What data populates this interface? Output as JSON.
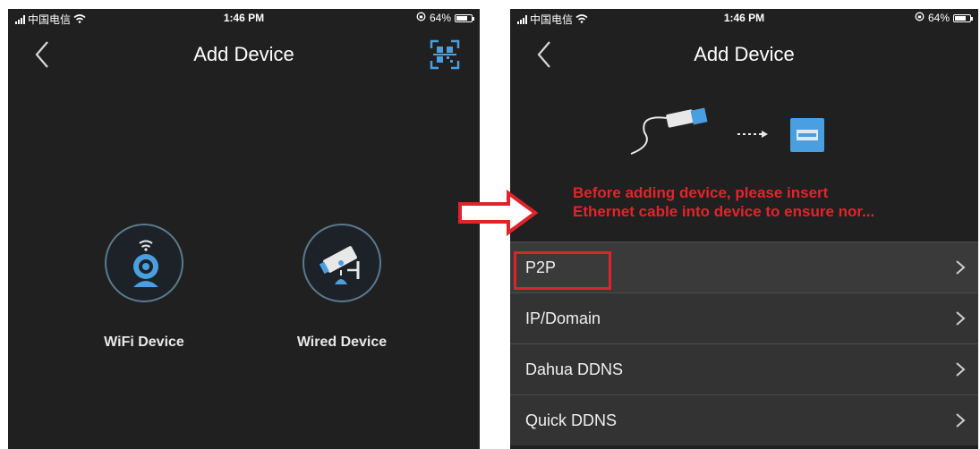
{
  "status_bar": {
    "carrier": "中国电信",
    "time": "1:46 PM",
    "battery": "64%",
    "battery_level": 0.64
  },
  "left_screen": {
    "title": "Add Device",
    "back_icon": "chevron-left-icon",
    "scan_icon": "qr-scan-icon",
    "options": [
      {
        "label": "WiFi Device",
        "icon": "wifi-camera-icon"
      },
      {
        "label": "Wired Device",
        "icon": "wired-camera-icon"
      }
    ]
  },
  "right_screen": {
    "title": "Add Device",
    "back_icon": "chevron-left-icon",
    "warning_lines": [
      "Before adding device, please insert",
      "Ethernet cable into device to ensure nor..."
    ],
    "methods": [
      {
        "label": "P2P",
        "highlighted": true
      },
      {
        "label": "IP/Domain"
      },
      {
        "label": "Dahua DDNS"
      },
      {
        "label": "Quick DDNS"
      }
    ]
  },
  "colors": {
    "background": "#202020",
    "accent_red": "#e4242a",
    "icon_blue": "#4a9fe0",
    "list_row": "#333333"
  }
}
